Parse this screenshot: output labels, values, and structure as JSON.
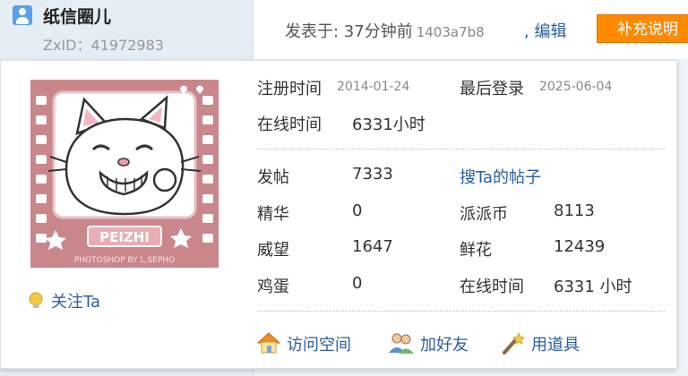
{
  "user": {
    "name": "纸信圈儿",
    "zxid": "ZxID：41972983"
  },
  "post": {
    "posted_label": "发表于: 37分钟前",
    "hash": "1403a7b8",
    "edit": ", 编辑",
    "supplement": "补充说明"
  },
  "avatar": {
    "caption": "PEIZHI",
    "credit": "PHOTOSHOP BY L.SEPHO"
  },
  "profile": {
    "reg_label": "注册时间",
    "reg_value": "2014-01-24",
    "last_label": "最后登录",
    "last_value": "2025-06-04",
    "online_label": "在线时间",
    "online_value": "6331小时"
  },
  "stats": {
    "posts_label": "发帖",
    "posts_value": "7333",
    "search_link": "搜Ta的帖子",
    "essence_label": "精华",
    "essence_value": "0",
    "coins_label": "派派币",
    "coins_value": "8113",
    "prestige_label": "威望",
    "prestige_value": "1647",
    "flowers_label": "鲜花",
    "flowers_value": "12439",
    "eggs_label": "鸡蛋",
    "eggs_value": "0",
    "online2_label": "在线时间",
    "online2_value": "6331 小时"
  },
  "follow": "关注Ta",
  "actions": {
    "visit": "访问空间",
    "add_friend": "加好友",
    "use_item": "用道具"
  },
  "colors": {
    "link": "#2b5fa3",
    "button": "#ff8a00",
    "avatar_bg": "#c9878c"
  }
}
